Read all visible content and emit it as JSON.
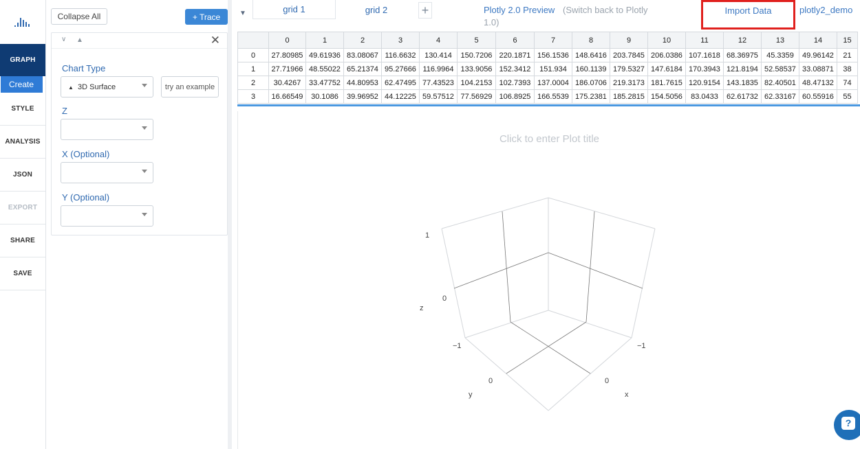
{
  "nav": {
    "items": [
      {
        "label": "GRAPH"
      },
      {
        "label": "Create"
      },
      {
        "label": "STYLE"
      },
      {
        "label": "ANALYSIS"
      },
      {
        "label": "JSON"
      },
      {
        "label": "EXPORT"
      },
      {
        "label": "SHARE"
      },
      {
        "label": "SAVE"
      }
    ]
  },
  "panel": {
    "collapse_label": "Collapse All",
    "trace_label": "+ Trace",
    "chart_type_label": "Chart Type",
    "chart_type_value": "3D Surface",
    "try_example_label": "try an example",
    "z_label": "Z",
    "x_label": "X (Optional)",
    "y_label": "Y (Optional)"
  },
  "tabs": {
    "grid1": "grid 1",
    "grid2": "grid 2",
    "plus": "+",
    "preview": "Plotly 2.0 Preview",
    "switch_line1": "(Switch back to Plotly",
    "switch_line2": "1.0)",
    "import": "Import Data",
    "user": "plotly2_demo"
  },
  "grid": {
    "columns": [
      "0",
      "1",
      "2",
      "3",
      "4",
      "5",
      "6",
      "7",
      "8",
      "9",
      "10",
      "11",
      "12",
      "13",
      "14",
      "15"
    ],
    "rows": [
      {
        "index": "0",
        "cells": [
          "27.80985",
          "49.61936",
          "83.08067",
          "116.6632",
          "130.414",
          "150.7206",
          "220.1871",
          "156.1536",
          "148.6416",
          "203.7845",
          "206.0386",
          "107.1618",
          "68.36975",
          "45.3359",
          "49.96142",
          "21"
        ]
      },
      {
        "index": "1",
        "cells": [
          "27.71966",
          "48.55022",
          "65.21374",
          "95.27666",
          "116.9964",
          "133.9056",
          "152.3412",
          "151.934",
          "160.1139",
          "179.5327",
          "147.6184",
          "170.3943",
          "121.8194",
          "52.58537",
          "33.08871",
          "38"
        ]
      },
      {
        "index": "2",
        "cells": [
          "30.4267",
          "33.47752",
          "44.80953",
          "62.47495",
          "77.43523",
          "104.2153",
          "102.7393",
          "137.0004",
          "186.0706",
          "219.3173",
          "181.7615",
          "120.9154",
          "143.1835",
          "82.40501",
          "48.47132",
          "74"
        ]
      },
      {
        "index": "3",
        "cells": [
          "16.66549",
          "30.1086",
          "39.96952",
          "44.12225",
          "59.57512",
          "77.56929",
          "106.8925",
          "166.5539",
          "175.2381",
          "185.2815",
          "154.5056",
          "83.0433",
          "62.61732",
          "62.33167",
          "60.55916",
          "55"
        ]
      }
    ]
  },
  "plot": {
    "title_placeholder": "Click to enter Plot title",
    "z_axis": "z",
    "y_axis": "y",
    "x_axis": "x",
    "z_ticks": [
      "1",
      "0",
      "−1"
    ],
    "y_tick": "0",
    "x_ticks": [
      "0",
      "−1"
    ]
  },
  "help": {
    "label": "?"
  }
}
